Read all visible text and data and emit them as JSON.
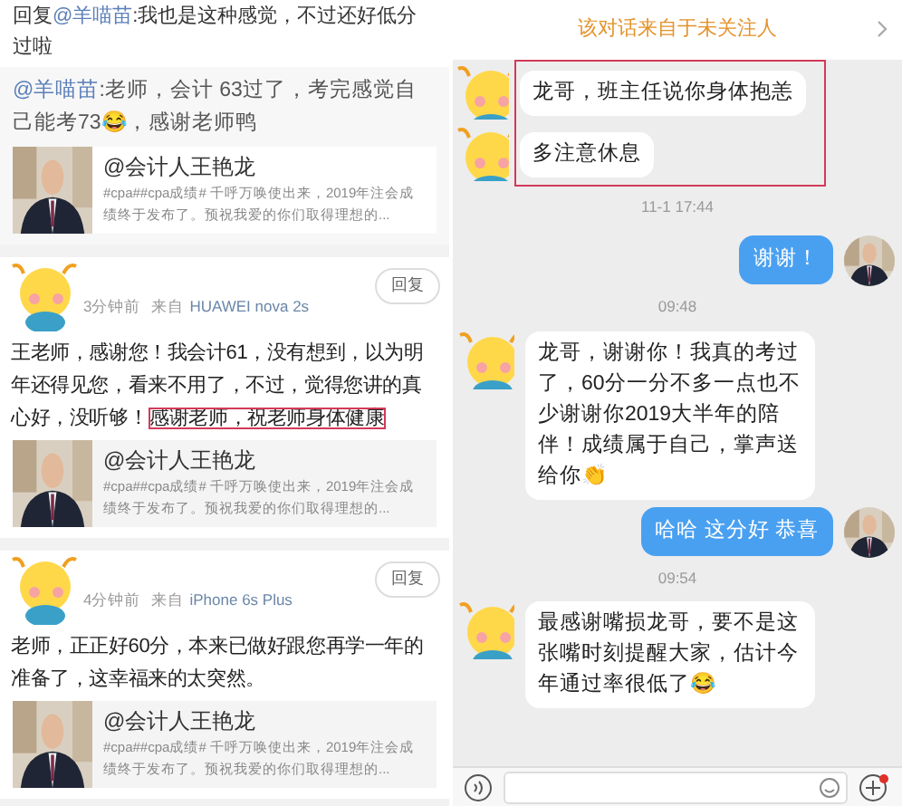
{
  "comments_panel": {
    "top_reply": {
      "prefix": "回复",
      "mention": "@羊喵苗",
      "text": ":我也是这种感觉，不过还好低分过啦"
    },
    "quoted": {
      "mention": "@羊喵苗",
      "text": ":老师，会计 63过了，考完感觉自己能考73😂，感谢老师鸭",
      "card": {
        "title": "@会计人王艳龙",
        "description": "#cpa##cpa成绩# 千呼万唤使出来，2019年注会成绩终于发布了。预祝我爱的你们取得理想的..."
      }
    },
    "comments": [
      {
        "time": "3分钟前",
        "source_label": "来自",
        "device": "HUAWEI nova 2s",
        "reply_button": "回复",
        "text": "王老师，感谢您！我会计61，没有想到，以为明年还得见您，看来不用了，不过，觉得您讲的真心好，没听够！",
        "highlight": "感谢老师，祝老师身体健康",
        "card": {
          "title": "@会计人王艳龙",
          "description": "#cpa##cpa成绩# 千呼万唤使出来，2019年注会成绩终于发布了。预祝我爱的你们取得理想的..."
        }
      },
      {
        "time": "4分钟前",
        "source_label": "来自",
        "device": "iPhone 6s Plus",
        "reply_button": "回复",
        "text": "老师，正正好60分，本来已做好跟您再学一年的准备了，这幸福来的太突然。",
        "card": {
          "title": "@会计人王艳龙",
          "description": "#cpa##cpa成绩# 千呼万唤使出来，2019年注会成绩终于发布了。预祝我爱的你们取得理想的..."
        }
      }
    ]
  },
  "chat_panel": {
    "notice": "该对话来自于未关注人",
    "messages": [
      {
        "kind": "incoming",
        "text": "龙哥，班主任说你身体抱恙",
        "highlighted": true
      },
      {
        "kind": "incoming",
        "text": "多注意休息",
        "highlighted": true
      },
      {
        "kind": "time",
        "text": "11-1 17:44"
      },
      {
        "kind": "outgoing",
        "text": "谢谢！"
      },
      {
        "kind": "time",
        "text": "09:48"
      },
      {
        "kind": "incoming",
        "text": "龙哥，谢谢你！我真的考过了，60分一分不多一点也不少谢谢你2019大半年的陪伴！成绩属于自己，掌声送给你👏",
        "highlighted": false
      },
      {
        "kind": "outgoing",
        "text": "哈哈 这分好 恭喜"
      },
      {
        "kind": "time",
        "text": "09:54"
      },
      {
        "kind": "incoming",
        "text": "最感谢嘴损龙哥，要不是这张嘴时刻提醒大家，估计今年通过率很低了😂",
        "highlighted": false
      }
    ]
  }
}
